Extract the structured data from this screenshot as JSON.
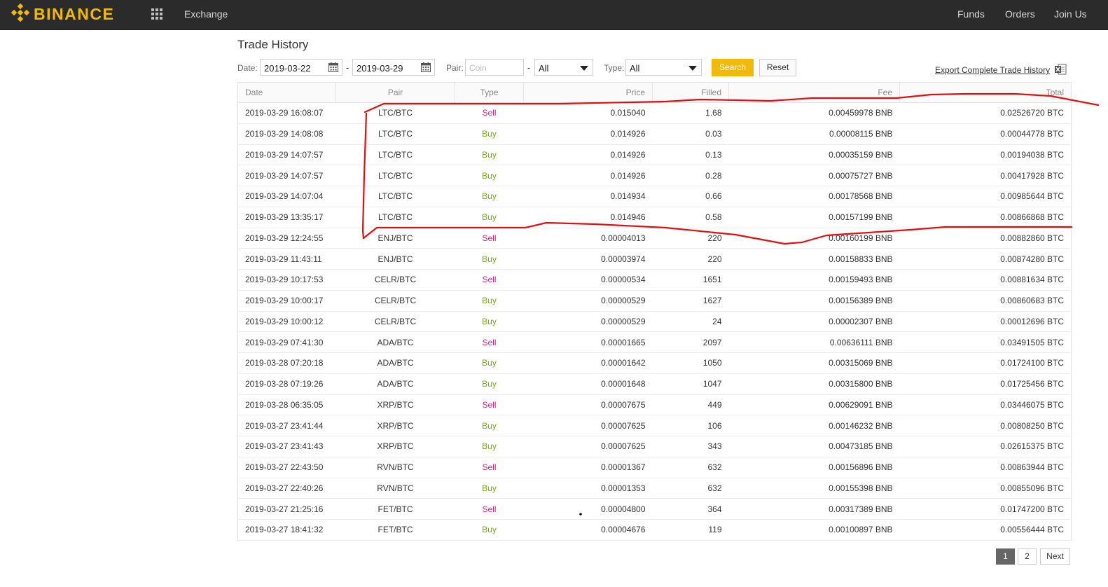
{
  "header": {
    "brand": "BINANCE",
    "nav_exchange": "Exchange",
    "nav_funds": "Funds",
    "nav_orders": "Orders",
    "nav_join": "Join Us",
    "brand_color": "#f0b90b",
    "icons": [
      "binance-logo-icon",
      "apps-grid-icon"
    ]
  },
  "page": {
    "title": "Trade History"
  },
  "filters": {
    "date_label": "Date:",
    "date_from": "2019-03-22",
    "date_sep": "-",
    "date_to": "2019-03-29",
    "pair_label": "Pair:",
    "pair_placeholder": "Coin",
    "pair_sep": "-",
    "pair_quote": "All",
    "type_label": "Type:",
    "type_value": "All",
    "search_label": "Search",
    "reset_label": "Reset",
    "export_label": "Export Complete Trade History",
    "search_color": "#f0b90b"
  },
  "table": {
    "columns": [
      "Date",
      "Pair",
      "Type",
      "Price",
      "Filled",
      "Fee",
      "Total"
    ],
    "rows": [
      [
        "2019-03-29 16:08:07",
        "LTC/BTC",
        "Sell",
        "0.015040",
        "1.68",
        "0.00459978 BNB",
        "0.02526720 BTC"
      ],
      [
        "2019-03-29 14:08:08",
        "LTC/BTC",
        "Buy",
        "0.014926",
        "0.03",
        "0.00008115 BNB",
        "0.00044778 BTC"
      ],
      [
        "2019-03-29 14:07:57",
        "LTC/BTC",
        "Buy",
        "0.014926",
        "0.13",
        "0.00035159 BNB",
        "0.00194038 BTC"
      ],
      [
        "2019-03-29 14:07:57",
        "LTC/BTC",
        "Buy",
        "0.014926",
        "0.28",
        "0.00075727 BNB",
        "0.00417928 BTC"
      ],
      [
        "2019-03-29 14:07:04",
        "LTC/BTC",
        "Buy",
        "0.014934",
        "0.66",
        "0.00178568 BNB",
        "0.00985644 BTC"
      ],
      [
        "2019-03-29 13:35:17",
        "LTC/BTC",
        "Buy",
        "0.014946",
        "0.58",
        "0.00157199 BNB",
        "0.00866868 BTC"
      ],
      [
        "2019-03-29 12:24:55",
        "ENJ/BTC",
        "Sell",
        "0.00004013",
        "220",
        "0.00160199 BNB",
        "0.00882860 BTC"
      ],
      [
        "2019-03-29 11:43:11",
        "ENJ/BTC",
        "Buy",
        "0.00003974",
        "220",
        "0.00158833 BNB",
        "0.00874280 BTC"
      ],
      [
        "2019-03-29 10:17:53",
        "CELR/BTC",
        "Sell",
        "0.00000534",
        "1651",
        "0.00159493 BNB",
        "0.00881634 BTC"
      ],
      [
        "2019-03-29 10:00:17",
        "CELR/BTC",
        "Buy",
        "0.00000529",
        "1627",
        "0.00156389 BNB",
        "0.00860683 BTC"
      ],
      [
        "2019-03-29 10:00:12",
        "CELR/BTC",
        "Buy",
        "0.00000529",
        "24",
        "0.00002307 BNB",
        "0.00012696 BTC"
      ],
      [
        "2019-03-29 07:41:30",
        "ADA/BTC",
        "Sell",
        "0.00001665",
        "2097",
        "0.00636111 BNB",
        "0.03491505 BTC"
      ],
      [
        "2019-03-28 07:20:18",
        "ADA/BTC",
        "Buy",
        "0.00001642",
        "1050",
        "0.00315069 BNB",
        "0.01724100 BTC"
      ],
      [
        "2019-03-28 07:19:26",
        "ADA/BTC",
        "Buy",
        "0.00001648",
        "1047",
        "0.00315800 BNB",
        "0.01725456 BTC"
      ],
      [
        "2019-03-28 06:35:05",
        "XRP/BTC",
        "Sell",
        "0.00007675",
        "449",
        "0.00629091 BNB",
        "0.03446075 BTC"
      ],
      [
        "2019-03-27 23:41:44",
        "XRP/BTC",
        "Buy",
        "0.00007625",
        "106",
        "0.00146232 BNB",
        "0.00808250 BTC"
      ],
      [
        "2019-03-27 23:41:43",
        "XRP/BTC",
        "Buy",
        "0.00007625",
        "343",
        "0.00473185 BNB",
        "0.02615375 BTC"
      ],
      [
        "2019-03-27 22:43:50",
        "RVN/BTC",
        "Sell",
        "0.00001367",
        "632",
        "0.00156896 BNB",
        "0.00863944 BTC"
      ],
      [
        "2019-03-27 22:40:26",
        "RVN/BTC",
        "Buy",
        "0.00001353",
        "632",
        "0.00155398 BNB",
        "0.00855096 BTC"
      ],
      [
        "2019-03-27 21:25:16",
        "FET/BTC",
        "Sell",
        "0.00004800",
        "364",
        "0.00317389 BNB",
        "0.01747200 BTC"
      ],
      [
        "2019-03-27 18:41:32",
        "FET/BTC",
        "Buy",
        "0.00004676",
        "119",
        "0.00100897 BNB",
        "0.00556444 BTC"
      ]
    ],
    "sell_color": "#e0208a",
    "buy_color": "#72b300"
  },
  "pagination": {
    "pages": [
      "1",
      "2"
    ],
    "current": "1",
    "next_label": "Next"
  },
  "annotation": {
    "color": "#e01010"
  }
}
